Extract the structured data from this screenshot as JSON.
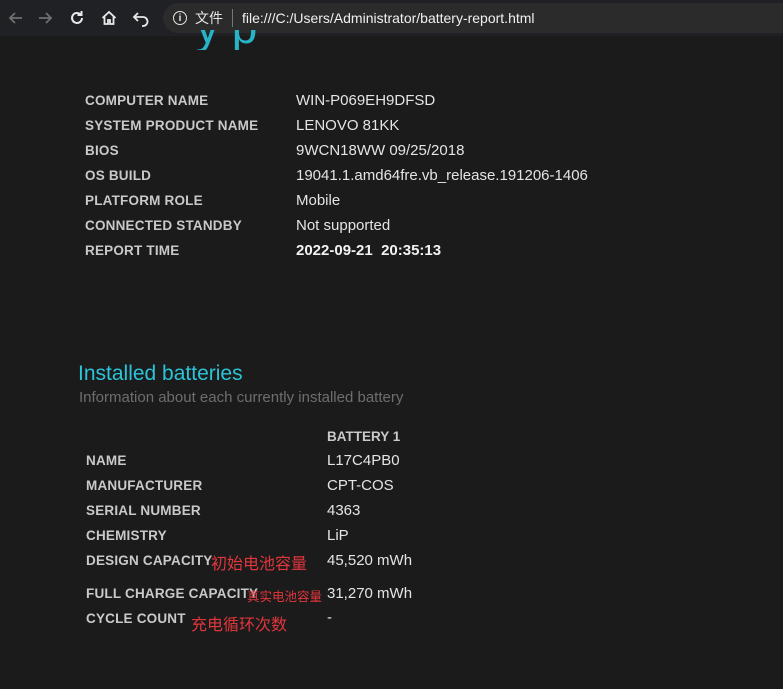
{
  "browser": {
    "scheme_label": "文件",
    "url": "file:///C:/Users/Administrator/battery-report.html"
  },
  "page": {
    "title_remnant": "y  p",
    "system_info": [
      {
        "label": "COMPUTER NAME",
        "value": "WIN-P069EH9DFSD"
      },
      {
        "label": "SYSTEM PRODUCT NAME",
        "value": "LENOVO 81KK"
      },
      {
        "label": "BIOS",
        "value": "9WCN18WW 09/25/2018"
      },
      {
        "label": "OS BUILD",
        "value": "19041.1.amd64fre.vb_release.191206-1406"
      },
      {
        "label": "PLATFORM ROLE",
        "value": "Mobile"
      },
      {
        "label": "CONNECTED STANDBY",
        "value": "Not supported"
      },
      {
        "label": "REPORT TIME",
        "value": "2022-09-21  20:35:13"
      }
    ],
    "installed_batteries": {
      "title": "Installed batteries",
      "subtitle": "Information about each currently installed battery",
      "column_header": "BATTERY 1",
      "rows": [
        {
          "label": "NAME",
          "value": "L17C4PB0"
        },
        {
          "label": "MANUFACTURER",
          "value": "CPT-COS"
        },
        {
          "label": "SERIAL NUMBER",
          "value": "4363"
        },
        {
          "label": "CHEMISTRY",
          "value": "LiP"
        },
        {
          "label": "DESIGN CAPACITY",
          "value": "45,520 mWh"
        },
        {
          "label": "FULL CHARGE CAPACITY",
          "value": "31,270 mWh"
        },
        {
          "label": "CYCLE COUNT",
          "value": "-"
        }
      ]
    },
    "annotations": {
      "design_capacity": "初始电池容量",
      "full_charge_capacity": "真实电池容量",
      "cycle_count": "充电循环次数"
    }
  },
  "colors": {
    "background": "#1b1b1b",
    "accent": "#2bc3d8",
    "annotation": "#e0363c"
  }
}
